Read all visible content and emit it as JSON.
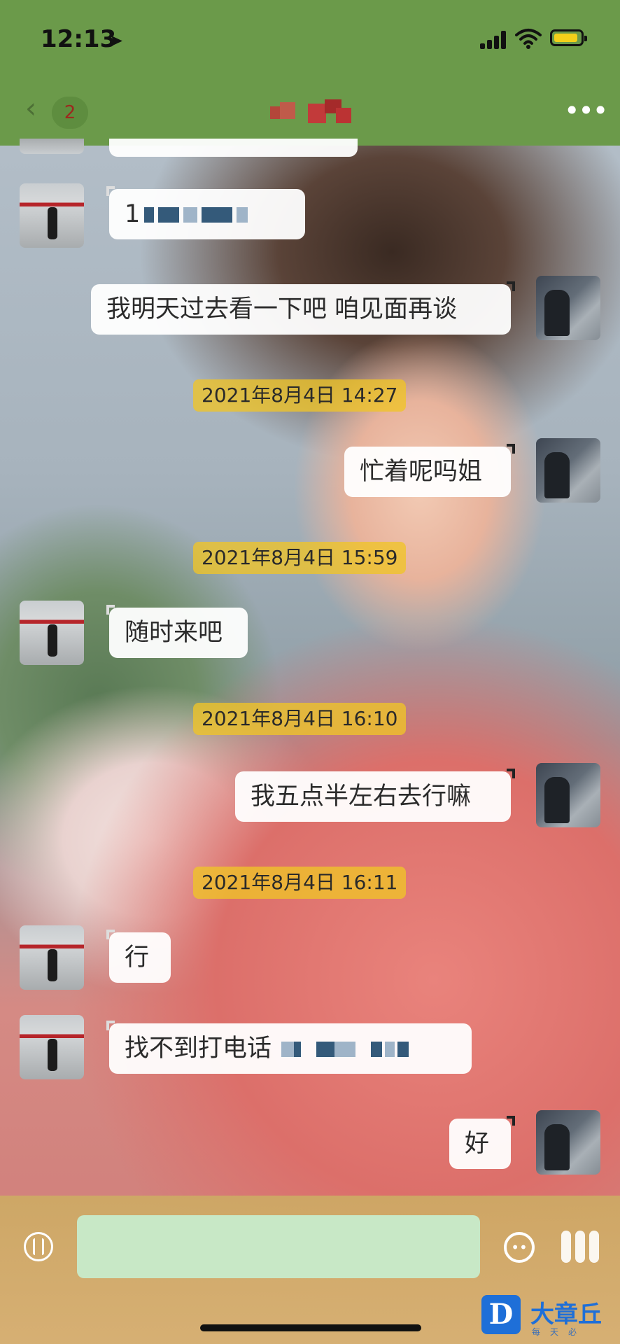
{
  "status_bar": {
    "time": "12:13",
    "battery_color": "#f3cf1a",
    "location_icon": "location-arrow-icon",
    "signal_icon": "cellular-signal-icon",
    "wifi_icon": "wifi-icon"
  },
  "nav": {
    "back_icon": "chevron-left-icon",
    "unread_count": "2",
    "more_icon": "ellipsis-icon",
    "bar_color": "#6b9a4a"
  },
  "messages": [
    {
      "side": "left",
      "text": "1"
    },
    {
      "side": "right",
      "text": "我明天过去看一下吧 咱见面再谈"
    },
    {
      "type": "timestamp",
      "text": "2021年8月4日 14:27"
    },
    {
      "side": "right",
      "text": "忙着呢吗姐"
    },
    {
      "type": "timestamp",
      "text": "2021年8月4日 15:59"
    },
    {
      "side": "left",
      "text": "随时来吧"
    },
    {
      "type": "timestamp",
      "text": "2021年8月4日 16:10"
    },
    {
      "side": "right",
      "text": "我五点半左右去行嘛"
    },
    {
      "type": "timestamp",
      "text": "2021年8月4日 16:11"
    },
    {
      "side": "left",
      "text": "行"
    },
    {
      "side": "left",
      "text": "找不到打电话"
    },
    {
      "side": "right",
      "text": "好"
    }
  ],
  "input_bar": {
    "placeholder": "",
    "voice_icon": "voice-icon",
    "emoji_icon": "emoji-icon",
    "more_icon": "plus-icon",
    "input_color": "#c8e8c6"
  },
  "watermark": {
    "logo_letter": "D",
    "title": "大章丘",
    "subtitle": "每天必"
  }
}
